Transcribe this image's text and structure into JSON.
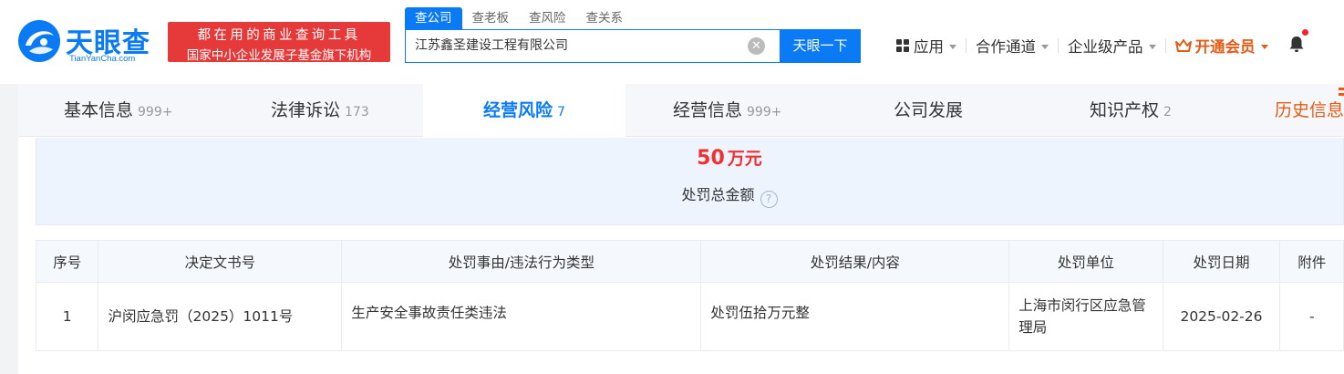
{
  "brand": {
    "name": "天眼查",
    "domain": "TianYanCha.com",
    "slogan_line1": "都在用的商业查询工具",
    "slogan_line2": "国家中小企业发展子基金旗下机构"
  },
  "search": {
    "tabs": [
      "查公司",
      "查老板",
      "查风险",
      "查关系"
    ],
    "active_tab": "查公司",
    "value": "江苏鑫圣建设工程有限公司",
    "button_label": "天眼一下"
  },
  "nav": {
    "apps_label": "应用",
    "channel_label": "合作通道",
    "enterprise_label": "企业级产品",
    "vip_label": "开通会员"
  },
  "tabs": [
    {
      "label": "基本信息",
      "count": "999+"
    },
    {
      "label": "法律诉讼",
      "count": "173"
    },
    {
      "label": "经营风险",
      "count": "7"
    },
    {
      "label": "经营信息",
      "count": "999+"
    },
    {
      "label": "公司发展",
      "count": ""
    },
    {
      "label": "知识产权",
      "count": "2"
    },
    {
      "label": "历史信息",
      "count": ""
    }
  ],
  "active_tab_index": 2,
  "summary": {
    "amount": "50",
    "amount_unit": "万元",
    "label": "处罚总金额",
    "help_glyph": "?"
  },
  "table": {
    "headers": [
      "序号",
      "决定文书号",
      "处罚事由/违法行为类型",
      "处罚结果/内容",
      "处罚单位",
      "处罚日期",
      "附件"
    ],
    "rows": [
      {
        "index": "1",
        "doc_no": "沪闵应急罚（2025）1011号",
        "reason": "生产安全事故责任类违法",
        "result": "处罚伍拾万元整",
        "authority": "上海市闵行区应急管理局",
        "date": "2025-02-26",
        "attachment": "-"
      }
    ]
  },
  "colors": {
    "brand_blue": "#0b7af5",
    "amount_red": "#f0302e",
    "slogan_red": "#e63a3a",
    "vip_orange": "#e65c16"
  }
}
